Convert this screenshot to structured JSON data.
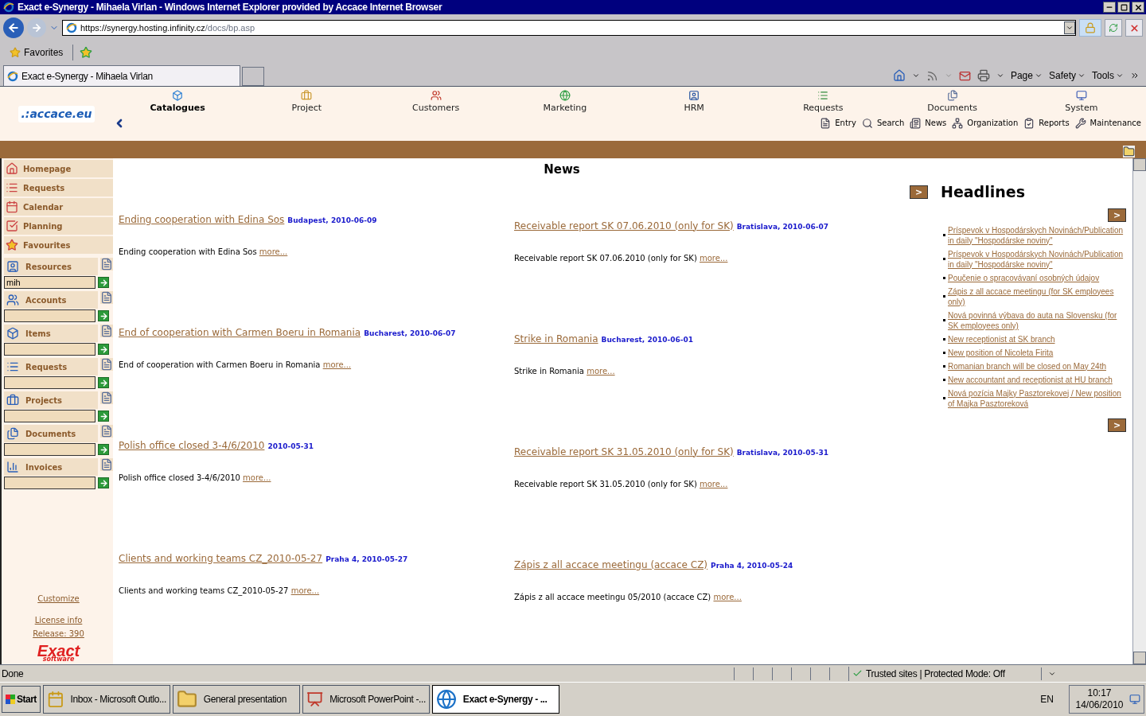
{
  "browser": {
    "title": "Exact e-Synergy - Mihaela Virlan - Windows Internet Explorer provided by Accace Internet Browser",
    "address": {
      "host": "https://synergy.hosting.infinity.cz",
      "path": "/docs/bp.asp"
    },
    "favorites": "Favorites",
    "tab": "Exact e-Synergy - Mihaela Virlan",
    "commands": [
      "Page",
      "Safety",
      "Tools"
    ]
  },
  "app": {
    "logo": ".:accace.eu",
    "modules": [
      {
        "label": "Catalogues",
        "selected": true
      },
      {
        "label": "Project",
        "selected": false
      },
      {
        "label": "Customers",
        "selected": false
      },
      {
        "label": "Marketing",
        "selected": false
      },
      {
        "label": "HRM",
        "selected": false
      },
      {
        "label": "Requests",
        "selected": false
      },
      {
        "label": "Documents",
        "selected": false
      },
      {
        "label": "System",
        "selected": false
      }
    ],
    "subnav": [
      "Entry",
      "Search",
      "News",
      "Organization",
      "Reports",
      "Maintenance"
    ]
  },
  "sidebar": {
    "links": [
      "Homepage",
      "Requests",
      "Calendar",
      "Planning",
      "Favourites"
    ],
    "searches": [
      {
        "label": "Resources",
        "value": "mih"
      },
      {
        "label": "Accounts"
      },
      {
        "label": "Items"
      },
      {
        "label": "Requests"
      },
      {
        "label": "Projects"
      },
      {
        "label": "Documents"
      },
      {
        "label": "Invoices"
      }
    ],
    "footer": [
      "Customize",
      "License info",
      "Release: 390"
    ],
    "brand": {
      "name": "Exact",
      "sub": "software"
    }
  },
  "news": {
    "heading": "News",
    "more_button": ">",
    "columns": [
      [
        {
          "title": "Ending cooperation with Edina Sos",
          "meta": "Budapest, 2010-06-09",
          "summary": "Ending cooperation with Edina Sos",
          "more": "more..."
        },
        {
          "title": "End of cooperation with Carmen Boeru in Romania",
          "meta": "Bucharest, 2010-06-07",
          "summary": "End of cooperation with Carmen Boeru in Romania",
          "more": "more..."
        },
        {
          "title": "Polish office closed 3-4/6/2010",
          "meta": "2010-05-31",
          "summary": "Polish office closed 3-4/6/2010",
          "more": "more..."
        },
        {
          "title": "Clients and working teams CZ_2010-05-27",
          "meta": "Praha 4, 2010-05-27",
          "summary": "Clients and working teams CZ_2010-05-27",
          "more": "more..."
        }
      ],
      [
        {
          "title": "Receivable report SK 07.06.2010 (only for SK)",
          "meta": "Bratislava, 2010-06-07",
          "summary": "Receivable report SK 07.06.2010 (only for SK)",
          "more": "more..."
        },
        {
          "title": "Strike in Romania",
          "meta": "Bucharest, 2010-06-01",
          "summary": "Strike in Romania",
          "more": "more..."
        },
        {
          "title": "Receivable report SK 31.05.2010 (only for SK)",
          "meta": "Bratislava, 2010-05-31",
          "summary": "Receivable report SK 31.05.2010 (only for SK)",
          "more": "more..."
        },
        {
          "title": "Zápis z all accace meetingu (accace CZ)",
          "meta": "Praha 4, 2010-05-24",
          "summary": "Zápis z all accace meetingu 05/2010 (accace CZ)",
          "more": "more..."
        }
      ]
    ]
  },
  "headlines": {
    "title": "Headlines",
    "buttons": [
      ">",
      ">"
    ],
    "items": [
      "Príspevok v Hospodárskych Novinách/Publication in daily \"Hospodárske noviny\"",
      "Príspevok v Hospodárskych Novinách/Publication in daily \"Hospodárske noviny\"",
      "Poučenie o spracovávaní osobných údajov",
      "Zápis z all accace meetingu (for SK employees only)",
      "Nová povinná výbava do auta na Slovensku (for SK employees only)",
      "New receptionist at SK branch",
      "New position of Nicoleta Firita",
      "Romanian branch will be closed on May 24th",
      "New accountant and receptionist at HU branch",
      "Nová pozícia Majky Pasztorekovej / New position of Majka Pasztoreková"
    ]
  },
  "status_bar": {
    "text": "Done",
    "zone": "Trusted sites | Protected Mode: Off"
  },
  "taskbar": {
    "start": "Start",
    "tasks": [
      {
        "label": "Inbox - Microsoft Outlo...",
        "selected": false
      },
      {
        "label": "General presentation",
        "selected": false
      },
      {
        "label": "Microsoft PowerPoint -...",
        "selected": false
      },
      {
        "label": "Exact e-Synergy - ...",
        "selected": true
      }
    ],
    "language": "EN",
    "time": "10:17",
    "date": "14/06/2010"
  }
}
